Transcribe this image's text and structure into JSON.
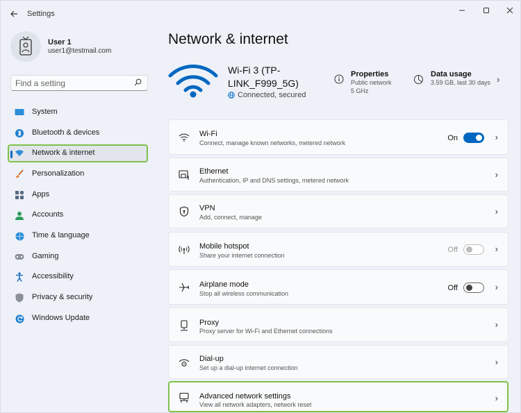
{
  "window": {
    "app_title": "Settings"
  },
  "user": {
    "name": "User 1",
    "email": "user1@testmail.com"
  },
  "search": {
    "placeholder": "Find a setting"
  },
  "sidebar": {
    "items": [
      {
        "label": "System",
        "icon": "system-icon"
      },
      {
        "label": "Bluetooth & devices",
        "icon": "bluetooth-icon"
      },
      {
        "label": "Network & internet",
        "icon": "network-icon",
        "active": true
      },
      {
        "label": "Personalization",
        "icon": "brush-icon"
      },
      {
        "label": "Apps",
        "icon": "apps-icon"
      },
      {
        "label": "Accounts",
        "icon": "accounts-icon"
      },
      {
        "label": "Time & language",
        "icon": "globe-clock-icon"
      },
      {
        "label": "Gaming",
        "icon": "gamepad-icon"
      },
      {
        "label": "Accessibility",
        "icon": "accessibility-icon"
      },
      {
        "label": "Privacy & security",
        "icon": "shield-icon"
      },
      {
        "label": "Windows Update",
        "icon": "update-icon"
      }
    ]
  },
  "main": {
    "title": "Network & internet",
    "connection": {
      "ssid": "Wi-Fi 3 (TP-LINK_F999_5G)",
      "status": "Connected, secured"
    },
    "properties": {
      "title": "Properties",
      "line1": "Public network",
      "line2": "5 GHz"
    },
    "data_usage": {
      "title": "Data usage",
      "line1": "3.59 GB, last 30 days"
    },
    "cards": [
      {
        "title": "Wi-Fi",
        "subtitle": "Connect, manage known networks, metered network",
        "toggle_label": "On",
        "icon": "wifi-icon"
      },
      {
        "title": "Ethernet",
        "subtitle": "Authentication, IP and DNS settings, metered network",
        "icon": "ethernet-icon"
      },
      {
        "title": "VPN",
        "subtitle": "Add, connect, manage",
        "icon": "vpn-shield-icon"
      },
      {
        "title": "Mobile hotspot",
        "subtitle": "Share your internet connection",
        "toggle_label": "Off",
        "icon": "hotspot-icon"
      },
      {
        "title": "Airplane mode",
        "subtitle": "Stop all wireless communication",
        "toggle_label": "Off",
        "icon": "airplane-icon"
      },
      {
        "title": "Proxy",
        "subtitle": "Proxy server for Wi-Fi and Ethernet connections",
        "icon": "proxy-icon"
      },
      {
        "title": "Dial-up",
        "subtitle": "Set up a dial-up internet connection",
        "icon": "dialup-icon"
      },
      {
        "title": "Advanced network settings",
        "subtitle": "View all network adapters, network reset",
        "icon": "advanced-network-icon"
      }
    ]
  },
  "colors": {
    "accent": "#0067c0",
    "highlight": "#7ec14a",
    "background": "#eef1f7"
  }
}
